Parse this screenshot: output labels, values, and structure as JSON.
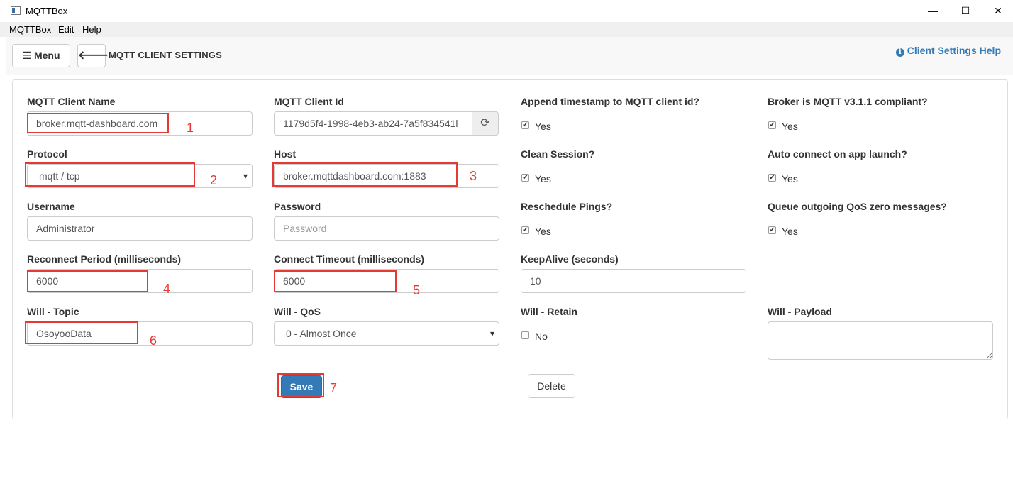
{
  "window": {
    "title": "MQTTBox",
    "minimize": "—",
    "maximize": "☐",
    "close": "✕"
  },
  "menubar": {
    "items": [
      "MQTTBox",
      "Edit",
      "Help"
    ]
  },
  "header": {
    "menu_label": "Menu",
    "title": "MQTT CLIENT SETTINGS",
    "help_label": "Client Settings Help"
  },
  "form": {
    "client_name": {
      "label": "MQTT Client Name",
      "value": "broker.mqtt-dashboard.com"
    },
    "client_id": {
      "label": "MQTT Client Id",
      "value": "1179d5f4-1998-4eb3-ab24-7a5f834541l"
    },
    "append_timestamp": {
      "label": "Append timestamp to MQTT client id?",
      "option": "Yes",
      "checked": true
    },
    "mqtt_311": {
      "label": "Broker is MQTT v3.1.1 compliant?",
      "option": "Yes",
      "checked": true
    },
    "protocol": {
      "label": "Protocol",
      "value": "mqtt / tcp"
    },
    "host": {
      "label": "Host",
      "value": "broker.mqttdashboard.com:1883"
    },
    "clean_session": {
      "label": "Clean Session?",
      "option": "Yes",
      "checked": true
    },
    "auto_connect": {
      "label": "Auto connect on app launch?",
      "option": "Yes",
      "checked": true
    },
    "username": {
      "label": "Username",
      "value": "Administrator"
    },
    "password": {
      "label": "Password",
      "placeholder": "Password"
    },
    "reschedule_pings": {
      "label": "Reschedule Pings?",
      "option": "Yes",
      "checked": true
    },
    "queue_qos0": {
      "label": "Queue outgoing QoS zero messages?",
      "option": "Yes",
      "checked": true
    },
    "reconnect_period": {
      "label": "Reconnect Period (milliseconds)",
      "value": "6000"
    },
    "connect_timeout": {
      "label": "Connect Timeout (milliseconds)",
      "value": "6000"
    },
    "keepalive": {
      "label": "KeepAlive (seconds)",
      "value": "10"
    },
    "will_topic": {
      "label": "Will - Topic",
      "value": "OsoyooData"
    },
    "will_qos": {
      "label": "Will - QoS",
      "value": "0 - Almost Once"
    },
    "will_retain": {
      "label": "Will - Retain",
      "option": "No",
      "checked": false
    },
    "will_payload": {
      "label": "Will - Payload",
      "value": ""
    },
    "save_label": "Save",
    "delete_label": "Delete"
  },
  "annotations": [
    "1",
    "2",
    "3",
    "4",
    "5",
    "6",
    "7"
  ],
  "colors": {
    "primary": "#337ab7",
    "annotation": "#e53935"
  }
}
